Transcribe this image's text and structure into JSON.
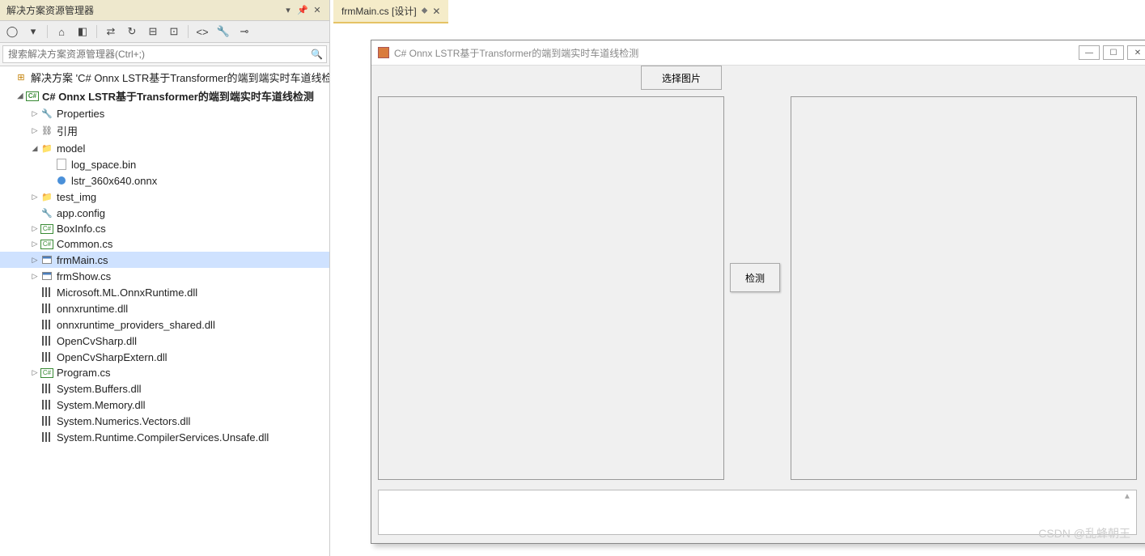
{
  "panel": {
    "title": "解决方案资源管理器"
  },
  "search": {
    "placeholder": "搜索解决方案资源管理器(Ctrl+;)"
  },
  "tree": {
    "solution": "解决方案 'C# Onnx LSTR基于Transformer的端到端实时车道线检测",
    "project": "C# Onnx LSTR基于Transformer的端到端实时车道线检测",
    "properties": "Properties",
    "references": "引用",
    "model": "model",
    "log_space": "log_space.bin",
    "lstr_onnx": "lstr_360x640.onnx",
    "test_img": "test_img",
    "app_config": "app.config",
    "boxinfo": "BoxInfo.cs",
    "common": "Common.cs",
    "frmmain": "frmMain.cs",
    "frmshow": "frmShow.cs",
    "ms_onnx": "Microsoft.ML.OnnxRuntime.dll",
    "onnxrt": "onnxruntime.dll",
    "onnxrt_prov": "onnxruntime_providers_shared.dll",
    "opencv": "OpenCvSharp.dll",
    "opencv_ext": "OpenCvSharpExtern.dll",
    "program": "Program.cs",
    "sys_buf": "System.Buffers.dll",
    "sys_mem": "System.Memory.dll",
    "sys_num": "System.Numerics.Vectors.dll",
    "sys_rt": "System.Runtime.CompilerServices.Unsafe.dll"
  },
  "tab": {
    "label": "frmMain.cs [设计]"
  },
  "form": {
    "title": "C# Onnx LSTR基于Transformer的端到端实时车道线检测",
    "btn_select": "选择图片",
    "btn_detect": "检测"
  },
  "watermark": "CSDN @乱蜂朝王"
}
